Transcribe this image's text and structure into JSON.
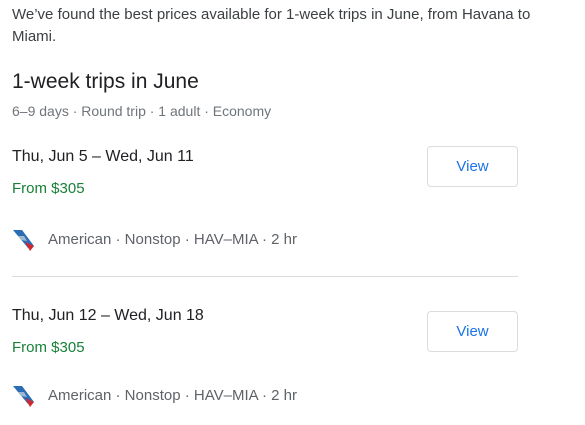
{
  "intro": "We’ve found the best prices available for 1-week trips in June, from Havana to Miami.",
  "title": "1-week trips in June",
  "meta": "6–9 days · Round trip · 1 adult · Economy",
  "trips": [
    {
      "dates": "Thu, Jun 5 – Wed, Jun 11",
      "price": "From $305",
      "view_label": "View",
      "airline_info": "American · Nonstop · HAV–MIA · 2 hr"
    },
    {
      "dates": "Thu, Jun 12 – Wed, Jun 18",
      "price": "From $305",
      "view_label": "View",
      "airline_info": "American · Nonstop · HAV–MIA · 2 hr"
    }
  ],
  "icons": {
    "airline_logo": "american-airlines-logo-icon"
  },
  "colors": {
    "price_green": "#188038",
    "link_blue": "#1a73e8",
    "logo_blue": "#2a6db5",
    "logo_red": "#d0272e"
  }
}
